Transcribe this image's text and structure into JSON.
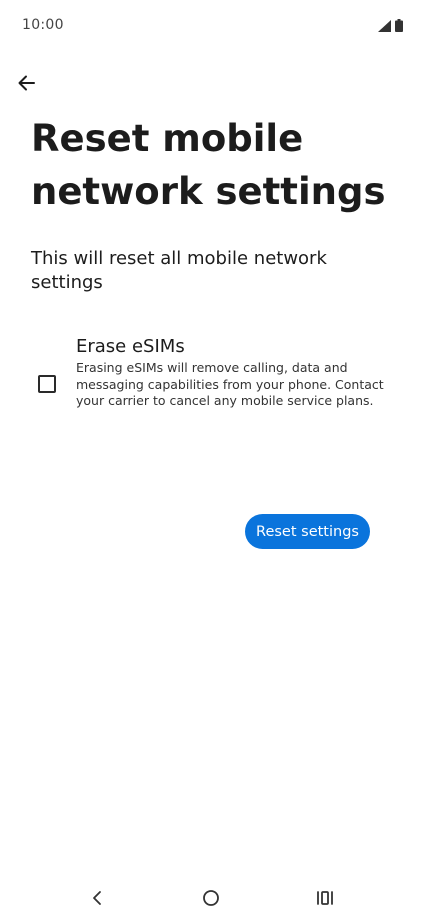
{
  "status_bar": {
    "time": "10:00",
    "signal_icon": "cellular-signal-icon",
    "battery_icon": "battery-icon"
  },
  "header": {
    "back_icon": "arrow-back-icon"
  },
  "main": {
    "title": "Reset mobile network settings",
    "description": "This will reset all mobile network settings",
    "esim_option": {
      "title": "Erase eSIMs",
      "description": "Erasing eSIMs will remove calling, data and messaging capabilities from your phone. Contact your carrier to cancel any mobile service plans.",
      "checked": false
    },
    "reset_button_label": "Reset settings"
  },
  "nav_bar": {
    "back_icon": "nav-back-icon",
    "home_icon": "nav-home-icon",
    "recents_icon": "nav-recents-icon"
  },
  "colors": {
    "accent": "#0a74dc",
    "text": "#1c1c1c",
    "background": "#ffffff"
  }
}
